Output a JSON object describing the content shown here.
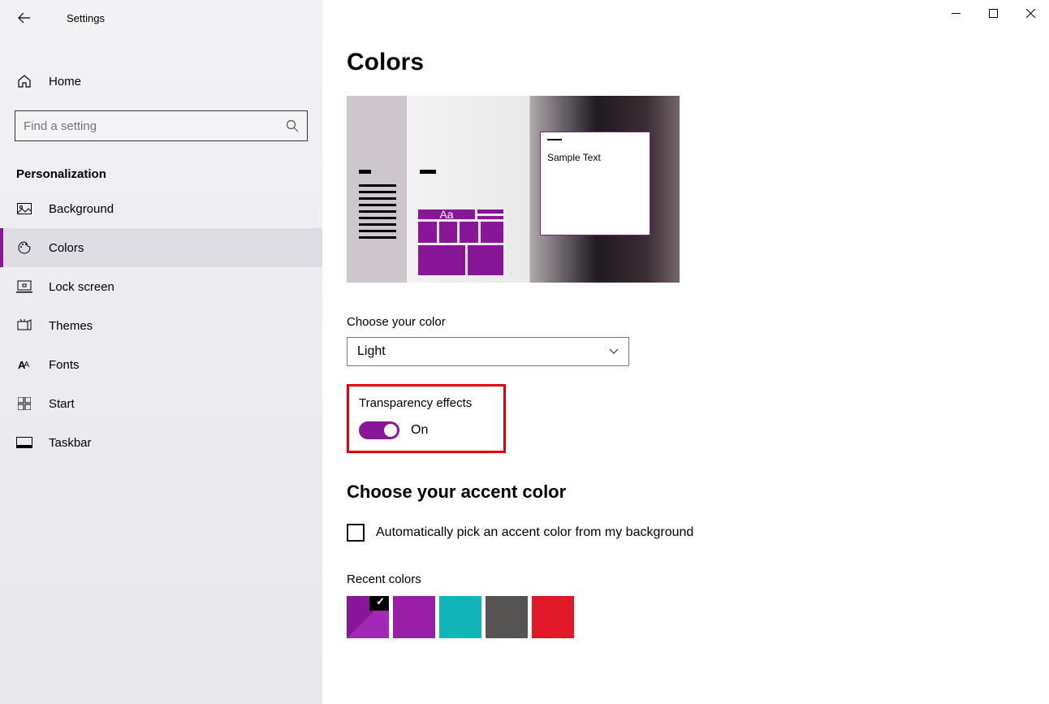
{
  "app_title": "Settings",
  "home_label": "Home",
  "search_placeholder": "Find a setting",
  "section_header": "Personalization",
  "nav": [
    {
      "label": "Background"
    },
    {
      "label": "Colors"
    },
    {
      "label": "Lock screen"
    },
    {
      "label": "Themes"
    },
    {
      "label": "Fonts"
    },
    {
      "label": "Start"
    },
    {
      "label": "Taskbar"
    }
  ],
  "page_title": "Colors",
  "preview_sample_text": "Sample Text",
  "preview_aa": "Aa",
  "choose_color_label": "Choose your color",
  "dropdown_value": "Light",
  "transparency_label": "Transparency effects",
  "transparency_state": "On",
  "accent_section_title": "Choose your accent color",
  "auto_accent_label": "Automatically pick an accent color from my background",
  "recent_colors_label": "Recent colors",
  "accent_color": "#881798",
  "recent_colors": [
    "#881798",
    "#991ea6",
    "#0fb5b8",
    "#565453",
    "#e11827"
  ],
  "selected_color_index": 0
}
